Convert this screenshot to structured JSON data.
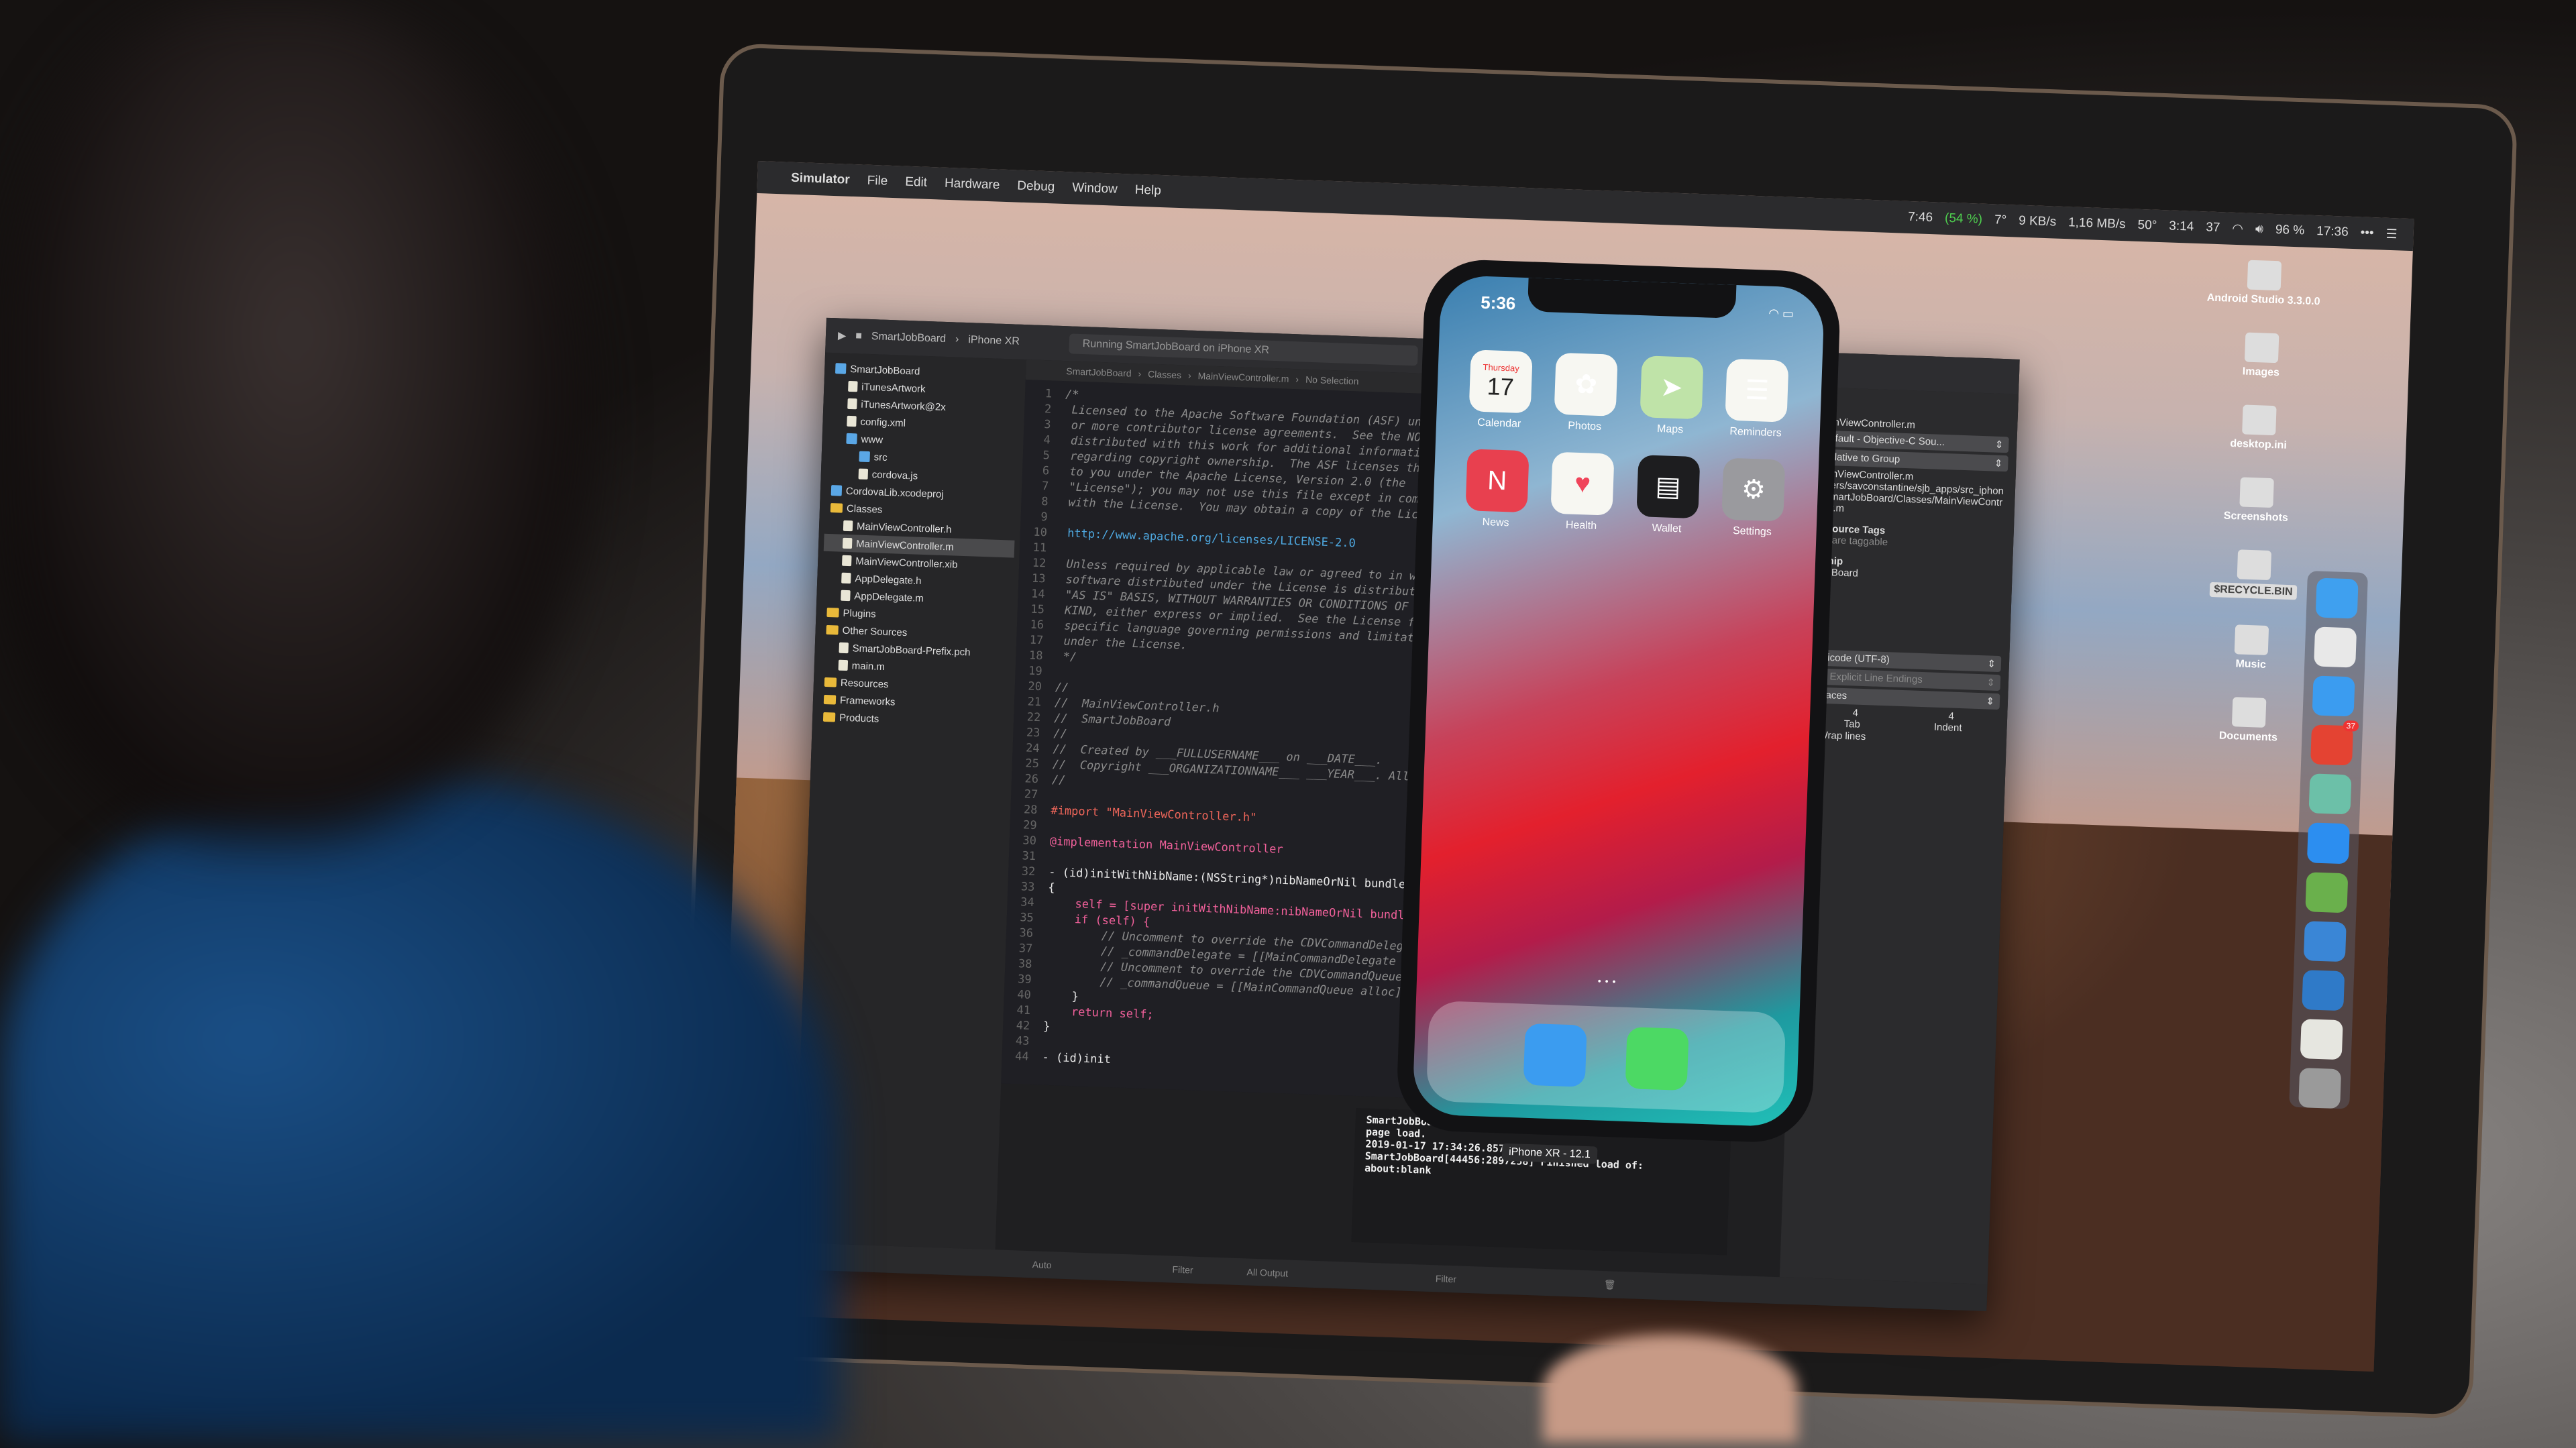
{
  "menubar": {
    "app": "Simulator",
    "items": [
      "File",
      "Edit",
      "Hardware",
      "Debug",
      "Window",
      "Help"
    ],
    "status": {
      "timer": "7:46",
      "percent": "(54 %)",
      "weather": "7°",
      "net_up": "9 KB/s",
      "net_down": "1,16 MB/s",
      "sensor": "50°",
      "battery_time": "3:14",
      "tasks": "37",
      "battery": "96 %",
      "clock": "17:36"
    }
  },
  "xcode": {
    "scheme": "SmartJobBoard",
    "device": "iPhone XR",
    "activity": "Running SmartJobBoard on iPhone XR",
    "jumpbar": [
      "SmartJobBoard",
      "Classes",
      "MainViewController.m",
      "No Selection"
    ],
    "navigator": [
      {
        "label": "SmartJobBoard",
        "type": "project",
        "depth": 0
      },
      {
        "label": "iTunesArtwork",
        "type": "file",
        "depth": 1
      },
      {
        "label": "iTunesArtwork@2x",
        "type": "file",
        "depth": 1
      },
      {
        "label": "config.xml",
        "type": "file",
        "depth": 1
      },
      {
        "label": "www",
        "type": "blue",
        "depth": 1
      },
      {
        "label": "src",
        "type": "blue",
        "depth": 2
      },
      {
        "label": "cordova.js",
        "type": "file",
        "depth": 2
      },
      {
        "label": "CordovaLib.xcodeproj",
        "type": "project",
        "depth": 0
      },
      {
        "label": "Classes",
        "type": "folder",
        "depth": 0
      },
      {
        "label": "MainViewController.h",
        "type": "file",
        "depth": 1
      },
      {
        "label": "MainViewController.m",
        "type": "file",
        "depth": 1,
        "selected": true
      },
      {
        "label": "MainViewController.xib",
        "type": "file",
        "depth": 1
      },
      {
        "label": "AppDelegate.h",
        "type": "file",
        "depth": 1
      },
      {
        "label": "AppDelegate.m",
        "type": "file",
        "depth": 1
      },
      {
        "label": "Plugins",
        "type": "folder",
        "depth": 0
      },
      {
        "label": "Other Sources",
        "type": "folder",
        "depth": 0
      },
      {
        "label": "SmartJobBoard-Prefix.pch",
        "type": "file",
        "depth": 1
      },
      {
        "label": "main.m",
        "type": "file",
        "depth": 1
      },
      {
        "label": "Resources",
        "type": "folder",
        "depth": 0
      },
      {
        "label": "Frameworks",
        "type": "folder",
        "depth": 0
      },
      {
        "label": "Products",
        "type": "folder",
        "depth": 0
      }
    ],
    "code": [
      {
        "n": "1",
        "t": "/*",
        "c": "com"
      },
      {
        "n": "2",
        "t": " Licensed to the Apache Software Foundation (ASF) under one",
        "c": "com"
      },
      {
        "n": "3",
        "t": " or more contributor license agreements.  See the NOTICE file",
        "c": "com"
      },
      {
        "n": "4",
        "t": " distributed with this work for additional information",
        "c": "com"
      },
      {
        "n": "5",
        "t": " regarding copyright ownership.  The ASF licenses this file",
        "c": "com"
      },
      {
        "n": "6",
        "t": " to you under the Apache License, Version 2.0 (the",
        "c": "com"
      },
      {
        "n": "7",
        "t": " \"License\"); you may not use this file except in compliance",
        "c": "com"
      },
      {
        "n": "8",
        "t": " with the License.  You may obtain a copy of the License at",
        "c": "com"
      },
      {
        "n": "9",
        "t": "",
        "c": "com"
      },
      {
        "n": "10",
        "t": " http://www.apache.org/licenses/LICENSE-2.0",
        "c": "url"
      },
      {
        "n": "11",
        "t": "",
        "c": "com"
      },
      {
        "n": "12",
        "t": " Unless required by applicable law or agreed to in writing,",
        "c": "com"
      },
      {
        "n": "13",
        "t": " software distributed under the License is distributed on an",
        "c": "com"
      },
      {
        "n": "14",
        "t": " \"AS IS\" BASIS, WITHOUT WARRANTIES OR CONDITIONS OF ANY",
        "c": "com"
      },
      {
        "n": "15",
        "t": " KIND, either express or implied.  See the License for the",
        "c": "com"
      },
      {
        "n": "16",
        "t": " specific language governing permissions and limitations",
        "c": "com"
      },
      {
        "n": "17",
        "t": " under the License.",
        "c": "com"
      },
      {
        "n": "18",
        "t": " */",
        "c": "com"
      },
      {
        "n": "19",
        "t": "",
        "c": "com"
      },
      {
        "n": "20",
        "t": "//",
        "c": "com"
      },
      {
        "n": "21",
        "t": "//  MainViewController.h",
        "c": "com"
      },
      {
        "n": "22",
        "t": "//  SmartJobBoard",
        "c": "com"
      },
      {
        "n": "23",
        "t": "//",
        "c": "com"
      },
      {
        "n": "24",
        "t": "//  Created by ___FULLUSERNAME___ on ___DATE___.",
        "c": "com"
      },
      {
        "n": "25",
        "t": "//  Copyright ___ORGANIZATIONNAME___ ___YEAR___. All rights reserved.",
        "c": "com"
      },
      {
        "n": "26",
        "t": "//",
        "c": "com"
      },
      {
        "n": "27",
        "t": "",
        "c": "com"
      },
      {
        "n": "28",
        "t": "#import \"MainViewController.h\"",
        "c": "str"
      },
      {
        "n": "29",
        "t": "",
        "c": "com"
      },
      {
        "n": "30",
        "t": "@implementation MainViewController",
        "c": "kw"
      },
      {
        "n": "31",
        "t": "",
        "c": "com"
      },
      {
        "n": "32",
        "t": "- (id)initWithNibName:(NSString*)nibNameOrNil bundle:(NSBundle*)",
        "c": "pl"
      },
      {
        "n": "33",
        "t": "{",
        "c": "pl"
      },
      {
        "n": "34",
        "t": "    self = [super initWithNibName:nibNameOrNil bundle:nibBundleOrNil];",
        "c": "kw"
      },
      {
        "n": "35",
        "t": "    if (self) {",
        "c": "kw"
      },
      {
        "n": "36",
        "t": "        // Uncomment to override the CDVCommandDelegateImpl",
        "c": "com"
      },
      {
        "n": "37",
        "t": "        // _commandDelegate = [[MainCommandDelegate alloc]",
        "c": "com"
      },
      {
        "n": "38",
        "t": "        // Uncomment to override the CDVCommandQueue used",
        "c": "com"
      },
      {
        "n": "39",
        "t": "        // _commandQueue = [[MainCommandQueue alloc] initWi",
        "c": "com"
      },
      {
        "n": "40",
        "t": "    }",
        "c": "pl"
      },
      {
        "n": "41",
        "t": "    return self;",
        "c": "kw"
      },
      {
        "n": "42",
        "t": "}",
        "c": "pl"
      },
      {
        "n": "43",
        "t": "",
        "c": "com"
      },
      {
        "n": "44",
        "t": "- (id)init",
        "c": "pl"
      }
    ],
    "console": [
      "SmartJobBoard[44456:2897   ugins due to",
      "page load.",
      "2019-01-17 17:34:26.857198+0600",
      "SmartJobBoard[44456:2897258] Finished load of:",
      "about:blank"
    ],
    "console_filter_mode": "All Output",
    "filter_placeholder": "Filter",
    "auto_label": "Auto",
    "tooltip": "iPhone XR - 12.1",
    "inspector": {
      "section_type": "ype",
      "name": "MainViewController.m",
      "file_type": "Default - Objective-C Sou...",
      "location": "Relative to Group",
      "filename": "MainViewController.m",
      "full_path": "/Users/savconstantine/sjb_apps/src_iphone/SmartJobBoard/Classes/MainViewController.m",
      "tags_header": "Resource Tags",
      "tags_note": "ces are taggable",
      "membership_header": "ership",
      "target": "tJobBoard",
      "encoding": "Unicode (UTF-8)",
      "line_endings": "No Explicit Line Endings",
      "indent_using": "Spaces",
      "tab": "4",
      "indent": "4",
      "tab_label": "Tab",
      "indent_label": "Indent",
      "wrap_label": "Wrap lines",
      "wrap": true
    }
  },
  "phone": {
    "time": "5:36",
    "apps": [
      {
        "label": "Calendar",
        "icon": "calendar-icon",
        "glyph": "17",
        "sub": "Thursday",
        "bg": "#f7f7f2"
      },
      {
        "label": "Photos",
        "icon": "photos-icon",
        "glyph": "✿",
        "bg": "#f7f7f2"
      },
      {
        "label": "Maps",
        "icon": "maps-icon",
        "glyph": "➤",
        "bg": "#bfe3a8"
      },
      {
        "label": "Reminders",
        "icon": "reminders-icon",
        "glyph": "☰",
        "bg": "#f7f7f2"
      },
      {
        "label": "News",
        "icon": "news-icon",
        "glyph": "N",
        "bg": "#e8404f"
      },
      {
        "label": "Health",
        "icon": "health-icon",
        "glyph": "♥",
        "bg": "#f7f7f2"
      },
      {
        "label": "Wallet",
        "icon": "wallet-icon",
        "glyph": "▤",
        "bg": "#1d1d1f"
      },
      {
        "label": "Settings",
        "icon": "settings-icon",
        "glyph": "⚙",
        "bg": "#9a9a9e"
      }
    ],
    "dock": [
      {
        "icon": "safari-icon",
        "bg": "#3b9cf0"
      },
      {
        "icon": "messages-icon",
        "bg": "#4cd964"
      }
    ]
  },
  "desktop": [
    {
      "label": "Android Studio 3.3.0.0"
    },
    {
      "label": "Images"
    },
    {
      "label": "desktop.ini"
    },
    {
      "label": "Screenshots"
    },
    {
      "label": "$RECYCLE.BIN"
    },
    {
      "label": "Music"
    },
    {
      "label": "Documents"
    }
  ],
  "mac_dock": [
    {
      "icon": "finder-icon",
      "bg": "#3fa0ef"
    },
    {
      "icon": "chrome-icon",
      "bg": "#e8e8e8"
    },
    {
      "icon": "safari-icon",
      "bg": "#3b9cf0"
    },
    {
      "icon": "todoist-icon",
      "bg": "#e44332",
      "badge": "37"
    },
    {
      "icon": "maps-app-icon",
      "bg": "#6cc0a8"
    },
    {
      "icon": "testflight-icon",
      "bg": "#2c8ef0"
    },
    {
      "icon": "android-studio-icon",
      "bg": "#6ab04c"
    },
    {
      "icon": "xcode-icon",
      "bg": "#3a86d6"
    },
    {
      "icon": "xcode-alt-icon",
      "bg": "#2f7ac8"
    },
    {
      "icon": "document-icon",
      "bg": "#e6e6e0"
    },
    {
      "icon": "trash-icon",
      "bg": "#9a9a9a"
    }
  ]
}
